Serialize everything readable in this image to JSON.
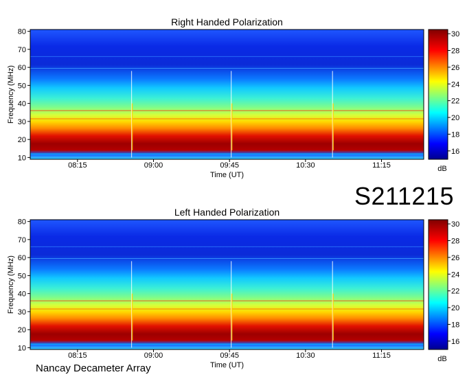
{
  "event_id": "S211215",
  "instrument": "Nancay Decameter Array",
  "chart_data": [
    {
      "type": "heatmap",
      "title": "Right Handed Polarization",
      "xlabel": "Time (UT)",
      "ylabel": "Frequency (MHz)",
      "x_ticks": [
        "08:15",
        "09:00",
        "09:45",
        "10:30",
        "11:15"
      ],
      "x_tick_minutes": [
        495,
        540,
        585,
        630,
        675
      ],
      "xlim_minutes": [
        467,
        700
      ],
      "y_ticks": [
        10,
        20,
        30,
        40,
        50,
        60,
        70,
        80
      ],
      "ylim": [
        9,
        81
      ],
      "colorbar": {
        "ticks": [
          16,
          18,
          20,
          22,
          24,
          26,
          28,
          30
        ],
        "range": [
          15,
          30.5
        ],
        "label": "dB"
      },
      "bursts_minutes": [
        527,
        586,
        646
      ],
      "grid": false
    },
    {
      "type": "heatmap",
      "title": "Left Handed Polarization",
      "xlabel": "Time (UT)",
      "ylabel": "Frequency (MHz)",
      "x_ticks": [
        "08:15",
        "09:00",
        "09:45",
        "10:30",
        "11:15"
      ],
      "x_tick_minutes": [
        495,
        540,
        585,
        630,
        675
      ],
      "xlim_minutes": [
        467,
        700
      ],
      "y_ticks": [
        10,
        20,
        30,
        40,
        50,
        60,
        70,
        80
      ],
      "ylim": [
        9,
        81
      ],
      "colorbar": {
        "ticks": [
          16,
          18,
          20,
          22,
          24,
          26,
          28,
          30
        ],
        "range": [
          15,
          30.5
        ],
        "label": "dB"
      },
      "bursts_minutes": [
        527,
        586,
        646
      ],
      "grid": false
    }
  ]
}
